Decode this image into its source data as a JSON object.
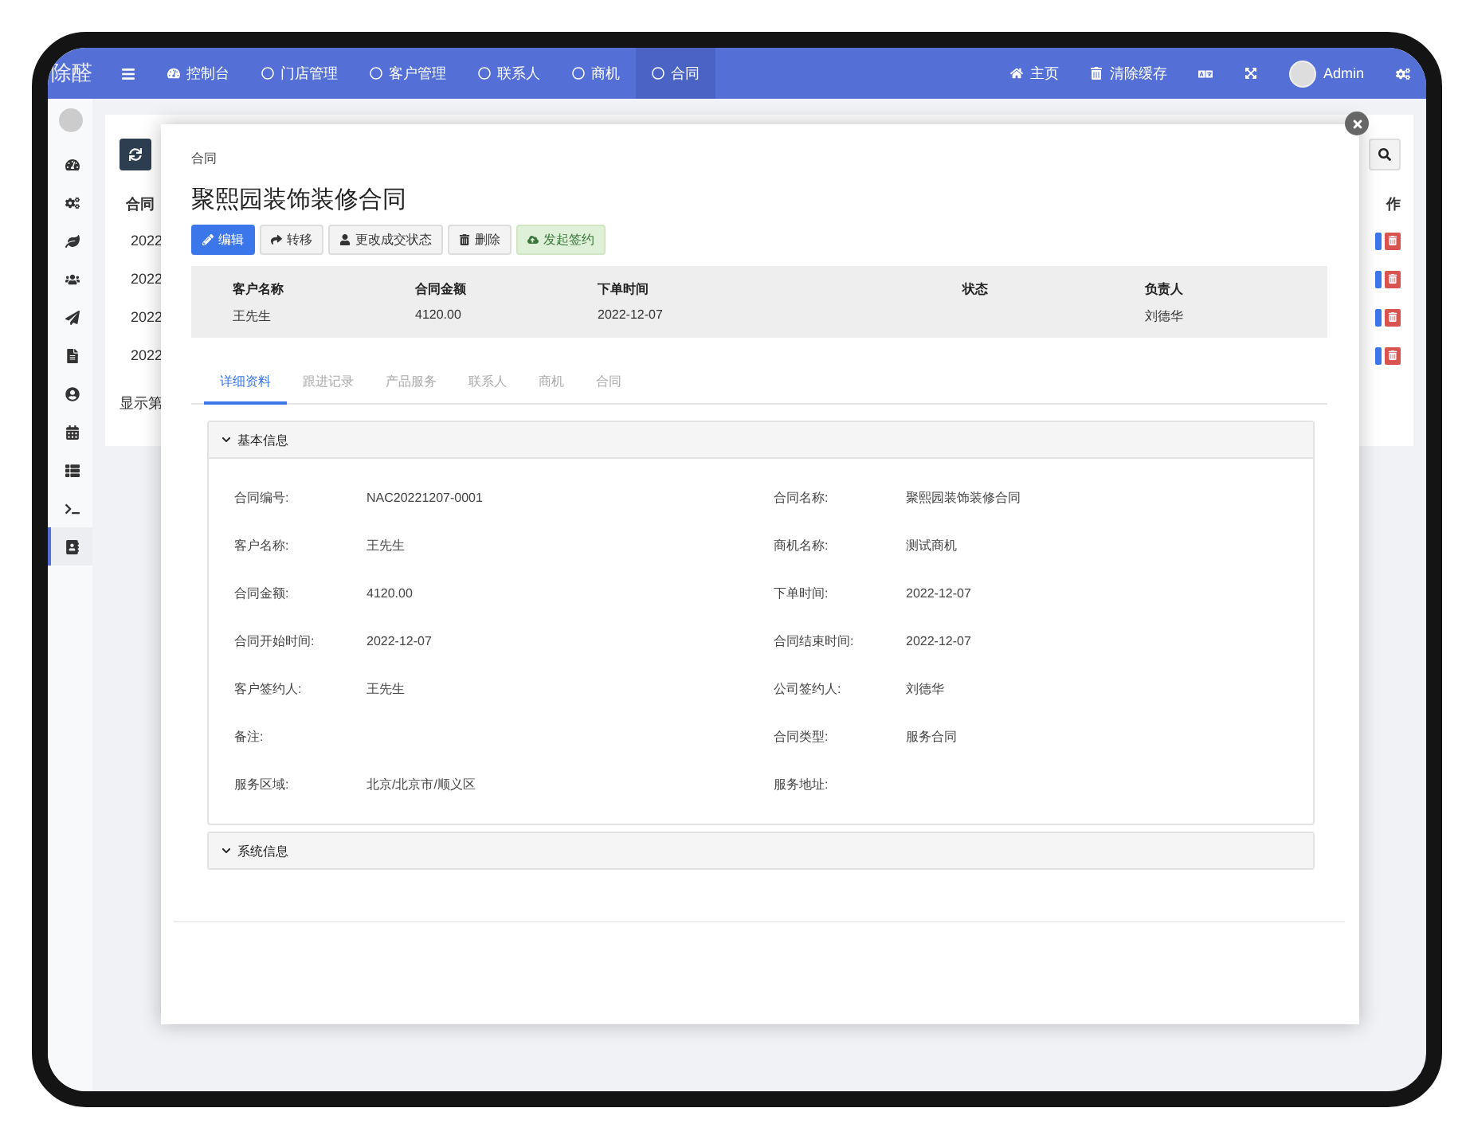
{
  "nav": {
    "brand": "除醛",
    "items": [
      {
        "label": "控制台",
        "selected": false
      },
      {
        "label": "门店管理",
        "selected": false
      },
      {
        "label": "客户管理",
        "selected": false
      },
      {
        "label": "联系人",
        "selected": false
      },
      {
        "label": "商机",
        "selected": false
      },
      {
        "label": "合同",
        "selected": true
      }
    ],
    "links": [
      {
        "label": "主页"
      },
      {
        "label": "清除缓存"
      }
    ],
    "user": {
      "name": "Admin"
    }
  },
  "sidebar": {
    "items": [
      {
        "selected": false
      },
      {
        "selected": false
      },
      {
        "selected": false
      },
      {
        "selected": false
      },
      {
        "selected": false
      },
      {
        "selected": false
      },
      {
        "selected": false
      },
      {
        "selected": false
      },
      {
        "selected": false
      },
      {
        "selected": false
      },
      {
        "selected": true
      }
    ]
  },
  "list": {
    "header": [
      "合同",
      "作"
    ],
    "rows": [
      {
        "cell": "2022"
      },
      {
        "cell": "2022"
      },
      {
        "cell": "2022"
      },
      {
        "cell": "2022"
      }
    ],
    "footer": "显示第"
  },
  "modal": {
    "breadcrumb": "合同",
    "title": "聚熙园装饰装修合同",
    "actions": [
      {
        "label": "编辑",
        "kind": "primary"
      },
      {
        "label": "转移",
        "kind": "default"
      },
      {
        "label": "更改成交状态",
        "kind": "default"
      },
      {
        "label": "删除",
        "kind": "default"
      },
      {
        "label": "发起签约",
        "kind": "success"
      }
    ],
    "summary": [
      {
        "label": "客户名称",
        "value": "王先生"
      },
      {
        "label": "合同金额",
        "value": "4120.00"
      },
      {
        "label": "下单时间",
        "value": "2022-12-07"
      },
      {
        "label": "状态"
      },
      {
        "label": "负责人",
        "value": "刘德华"
      }
    ],
    "tabs": [
      {
        "label": "详细资料",
        "selected": true
      },
      {
        "label": "跟进记录",
        "selected": false
      },
      {
        "label": "产品服务",
        "selected": false
      },
      {
        "label": "联系人",
        "selected": false
      },
      {
        "label": "商机",
        "selected": false
      },
      {
        "label": "合同",
        "selected": false
      }
    ],
    "sections": [
      {
        "title": "基本信息",
        "fields": [
          {
            "label": "合同编号:",
            "value": "NAC20221207-0001"
          },
          {
            "label": "合同名称:",
            "value": "聚熙园装饰装修合同"
          },
          {
            "label": "客户名称:",
            "value": "王先生"
          },
          {
            "label": "商机名称:",
            "value": "测试商机"
          },
          {
            "label": "合同金额:",
            "value": "4120.00"
          },
          {
            "label": "下单时间:",
            "value": "2022-12-07"
          },
          {
            "label": "合同开始时间:",
            "value": "2022-12-07"
          },
          {
            "label": "合同结束时间:",
            "value": "2022-12-07"
          },
          {
            "label": "客户签约人:",
            "value": "王先生"
          },
          {
            "label": "公司签约人:",
            "value": "刘德华"
          },
          {
            "label": "备注:"
          },
          {
            "label": "合同类型:",
            "value": "服务合同"
          },
          {
            "label": "服务区域:",
            "value": "北京/北京市/顺义区"
          },
          {
            "label": "服务地址:"
          }
        ]
      },
      {
        "title": "系统信息"
      }
    ]
  }
}
